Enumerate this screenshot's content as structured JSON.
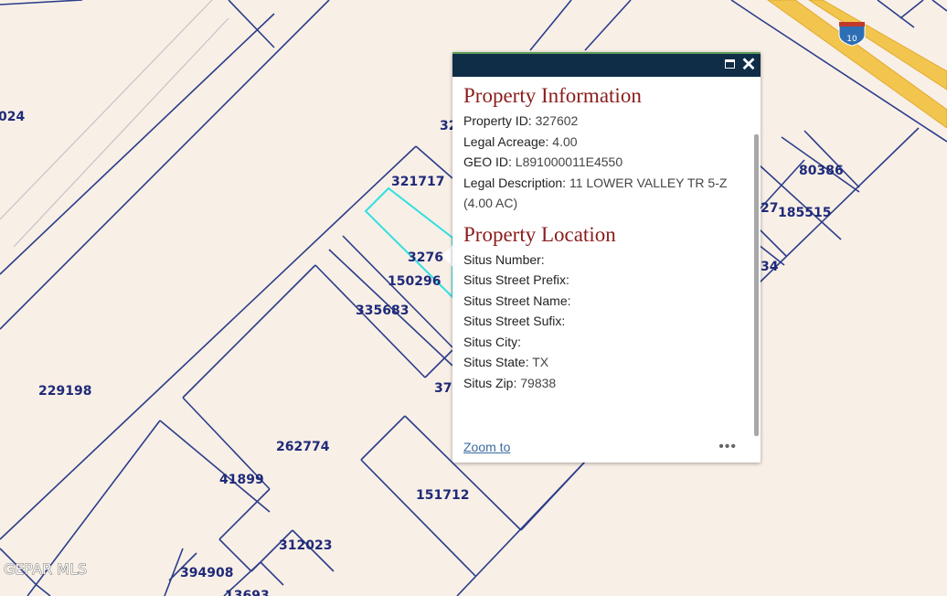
{
  "map": {
    "parcels": [
      {
        "id": "024"
      },
      {
        "id": "321717"
      },
      {
        "id": "32"
      },
      {
        "id": "3276"
      },
      {
        "id": "150296"
      },
      {
        "id": "335683"
      },
      {
        "id": "229198"
      },
      {
        "id": "37"
      },
      {
        "id": "262774"
      },
      {
        "id": "41899"
      },
      {
        "id": "151712"
      },
      {
        "id": "312023"
      },
      {
        "id": "394908"
      },
      {
        "id": "13693"
      },
      {
        "id": "80386"
      },
      {
        "id": "185515"
      },
      {
        "id": "27"
      },
      {
        "id": "34"
      }
    ],
    "highway_shield": "10",
    "watermark": "GEPAR MLS",
    "colors": {
      "background": "#f8efe6",
      "parcel_line": "#2b3d8a",
      "selected_outline": "#33e0e0",
      "highway": "#f2c64e"
    }
  },
  "popup": {
    "colors": {
      "header": "#102d47",
      "title": "#8a1c1c"
    },
    "sections": [
      {
        "title": "Property Information",
        "fields": [
          {
            "key": "Property ID:",
            "value": "327602"
          },
          {
            "key": "Legal Acreage:",
            "value": "4.00"
          },
          {
            "key": "GEO ID:",
            "value": "L891000011E4550"
          },
          {
            "key": "Legal Description:",
            "value": "11 LOWER VALLEY TR 5-Z (4.00 AC)"
          }
        ]
      },
      {
        "title": "Property Location",
        "fields": [
          {
            "key": "Situs Number:",
            "value": ""
          },
          {
            "key": "Situs Street Prefix:",
            "value": ""
          },
          {
            "key": "Situs Street Name:",
            "value": ""
          },
          {
            "key": "Situs Street Sufix:",
            "value": ""
          },
          {
            "key": "Situs City:",
            "value": ""
          },
          {
            "key": "Situs State:",
            "value": "TX"
          },
          {
            "key": "Situs Zip:",
            "value": "79838"
          }
        ]
      }
    ],
    "zoom_link": "Zoom to",
    "more_icon": "•••",
    "close_icon": "✕"
  }
}
